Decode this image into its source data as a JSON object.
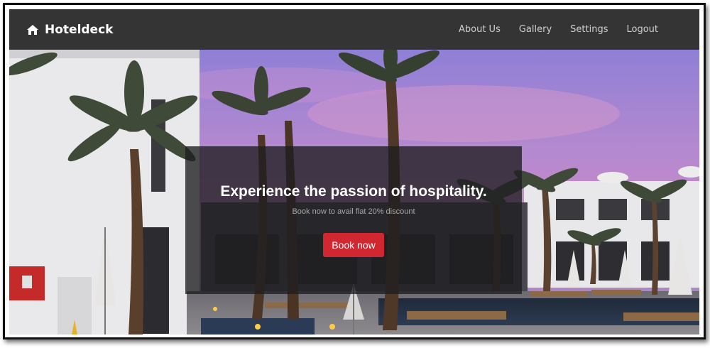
{
  "navbar": {
    "brand_name": "Hoteldeck",
    "brand_icon": "home-icon",
    "links": [
      {
        "label": "About Us"
      },
      {
        "label": "Gallery"
      },
      {
        "label": "Settings"
      },
      {
        "label": "Logout"
      }
    ]
  },
  "hero": {
    "headline": "Experience the passion of hospitality.",
    "subline": "Book now to avail flat 20% discount",
    "cta_label": "Book now"
  },
  "colors": {
    "navbar_bg": "#343434",
    "cta_bg": "#d02731",
    "sky_top": "#8f7fd6",
    "sky_pink": "#c98ac8"
  }
}
